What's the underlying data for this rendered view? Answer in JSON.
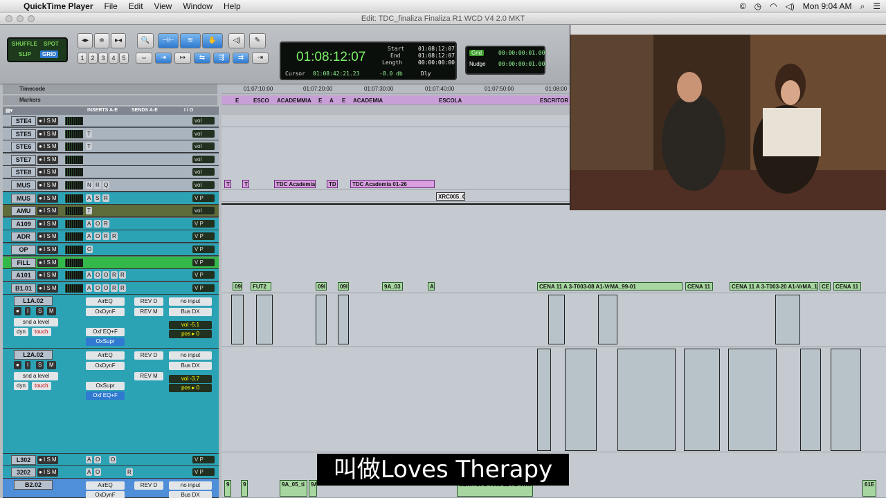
{
  "menubar": {
    "app_name": "QuickTime Player",
    "items": [
      "File",
      "Edit",
      "View",
      "Window",
      "Help"
    ],
    "clock": "Mon 9:04 AM"
  },
  "window": {
    "title": "Edit: TDC_finaliza Finaliza R1 WCD V4 2.0 MKT"
  },
  "toolbar": {
    "modes": [
      "SHUFFLE",
      "SPOT",
      "SLIP",
      "GRID"
    ],
    "zoom_presets": [
      "1",
      "2",
      "3",
      "4",
      "5"
    ],
    "main_counter": "01:08:12:07",
    "start_label": "Start",
    "start_value": "01:08:12:07",
    "end_label": "End",
    "end_value": "01:08:12:07",
    "length_label": "Length",
    "length_value": "00:00:00:00",
    "cursor_label": "Cursor",
    "cursor_value": "01:08:42:21.23",
    "cursor_db": "-8.0 db",
    "dly_label": "Dly",
    "grid_label": "Grid",
    "grid_value": "00:00:00:01.00",
    "nudge_label": "Nudge",
    "nudge_value": "00:00:00:01.00"
  },
  "rulers": {
    "timecode_label": "Timecode",
    "markers_label": "Markers",
    "ticks": [
      "01:07:10:00",
      "01:07:20:00",
      "01:07:30:00",
      "01:07:40:00",
      "01:07:50:00",
      "01:08:00"
    ],
    "markers": [
      "E",
      "ESCO",
      "ACADEMMIA",
      "E",
      "A",
      "E",
      "ACADEMIA",
      "ESCOLA",
      "ESCRITOR"
    ]
  },
  "columns": {
    "inserts": "INSERTS A-E",
    "sends": "SENDS A-E",
    "io": "I / O"
  },
  "tracks": [
    {
      "name": "STE4",
      "ins": [],
      "vol": "vol"
    },
    {
      "name": "STE5",
      "ins": [
        "T"
      ],
      "vol": "vol"
    },
    {
      "name": "STE6",
      "ins": [
        "T"
      ],
      "vol": "vol"
    },
    {
      "name": "STE7",
      "ins": [],
      "vol": "vol"
    },
    {
      "name": "STE8",
      "ins": [],
      "vol": "vol"
    },
    {
      "name": "MUS",
      "ins": [
        "N",
        "R",
        "Q"
      ],
      "vol": "vol"
    },
    {
      "name": "MUS",
      "ins": [
        "A",
        "S",
        "R"
      ],
      "vol": "V P"
    },
    {
      "name": "AMU",
      "ins": [
        "T"
      ],
      "vol": "vol"
    },
    {
      "name": "A109",
      "ins": [
        "A",
        "O",
        "R"
      ],
      "vol": "V P"
    },
    {
      "name": "ADR",
      "ins": [
        "A",
        "O",
        "R",
        "R"
      ],
      "vol": "V P"
    },
    {
      "name": "OP",
      "ins": [
        "O"
      ],
      "vol": "V P"
    },
    {
      "name": "FILL",
      "ins": [],
      "vol": "V P"
    },
    {
      "name": "A101",
      "ins": [
        "A",
        "O",
        "O",
        "R",
        "R"
      ],
      "vol": "V P"
    },
    {
      "name": "B1.01",
      "ins": [
        "A",
        "O",
        "O",
        "R",
        "R"
      ],
      "vol": "V P"
    }
  ],
  "big_tracks": [
    {
      "name": "L1A.02",
      "plugins": [
        "AirEQ",
        "OxDynF",
        "Oxf EQ+F",
        "OxSupr"
      ],
      "sends": [
        "REV D",
        "REV M"
      ],
      "io_in": "no input",
      "io_out": "Bus DX",
      "vol": "vol  -5.1",
      "pos": "pos  ▸ 0",
      "send_level": "snd a level",
      "mode_a": "dyn",
      "mode_b": "touch"
    },
    {
      "name": "L2A.02",
      "plugins": [
        "AirEQ",
        "OxDynF",
        "OxSupr",
        "Oxf EQ+F"
      ],
      "sends": [
        "REV D",
        "REV M"
      ],
      "io_in": "no input",
      "io_out": "Bus DX",
      "vol": "vol  -3.7",
      "pos": "pos  ▸ 0",
      "send_level": "snd a level",
      "mode_a": "dyn",
      "mode_b": "touch"
    }
  ],
  "bottom_tracks": [
    {
      "name": "L302",
      "ins": [
        "A",
        "O",
        "O"
      ],
      "vol": "V P"
    },
    {
      "name": "3202",
      "ins": [
        "A",
        "O",
        "R"
      ],
      "vol": "V P"
    },
    {
      "name": "B2.02",
      "plugins": [
        "AirEQ",
        "OxDynF"
      ],
      "sends": [
        "REV D"
      ],
      "io_in": "no input",
      "io_out": "Bus DX"
    }
  ],
  "clips": {
    "mus_row": [
      "T",
      "T",
      "TDC Academia",
      "TD",
      "TDC Academia 01-26"
    ],
    "xrc": "XRC005_C",
    "b101_row": [
      "09I",
      "FUT2",
      "09I",
      "09I",
      "9A_03",
      "A",
      "CENA 11 A 3-T003-08 A1-VrMA_99-01",
      "CENA 11",
      "CENA 11 A 3-T003-20 A1-VrMA_1",
      "CE",
      "CENA 11"
    ],
    "b202_row": [
      "9",
      "9",
      "9A_05_ti",
      "9A",
      "CENA 10 1-T003-22 A1-VrMA",
      "61E"
    ]
  },
  "subtitle": "叫做Loves Therapy",
  "colors": {
    "track_teal": "#2ba3b5",
    "track_green": "#35b84a",
    "track_blue": "#4f8ed8",
    "clip_green": "#a8d6a0",
    "clip_purple": "#d9a0e0",
    "counter_green": "#7cf06a"
  }
}
